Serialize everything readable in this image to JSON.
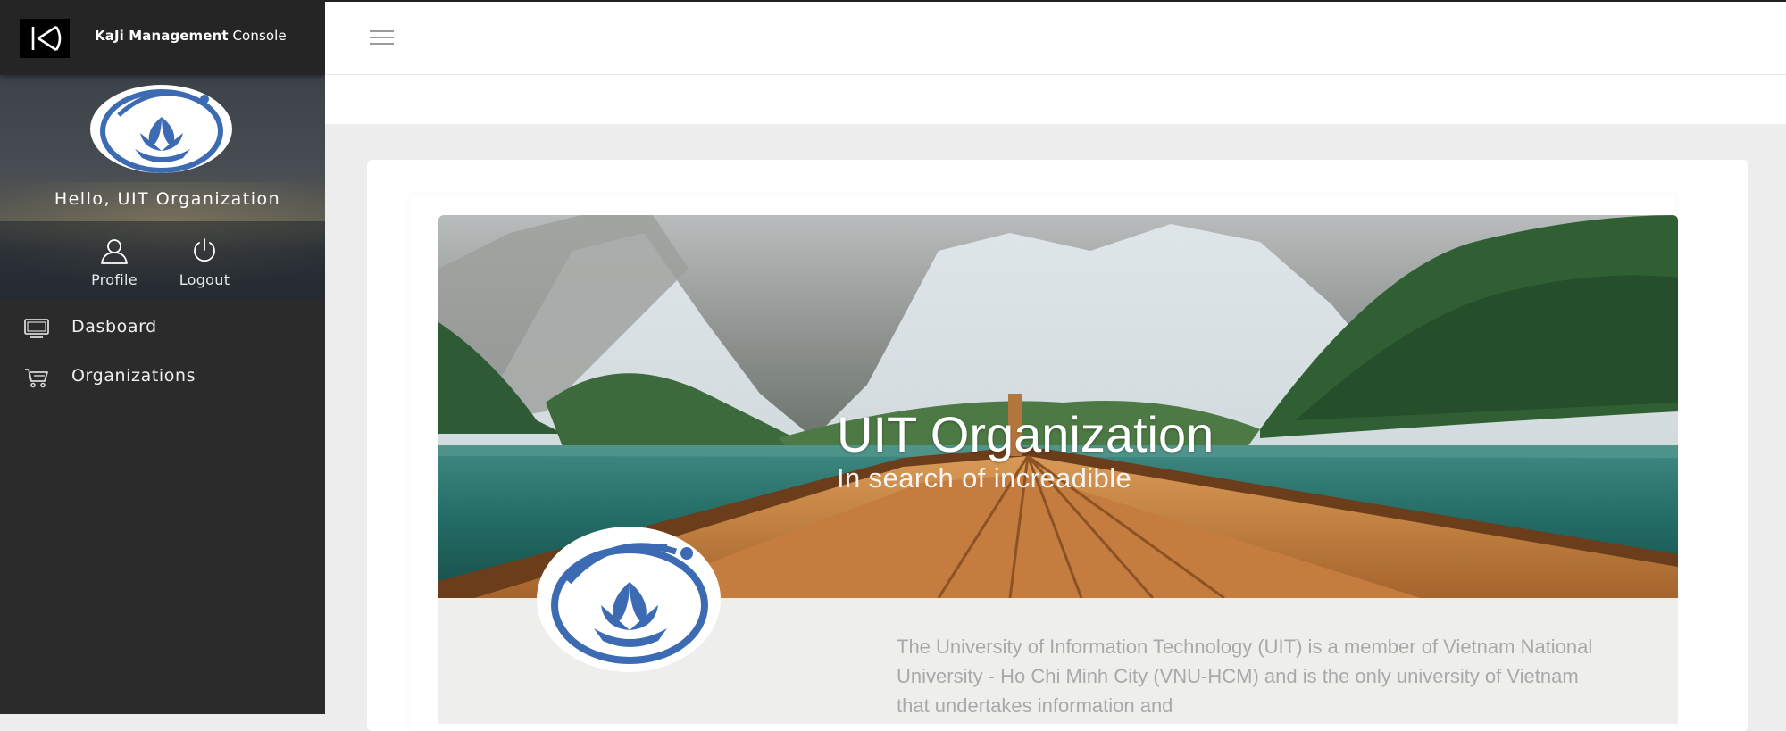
{
  "app": {
    "brand_bold": "KaJi Management",
    "brand_light": "Console",
    "logo_icon": "kaji-logo-icon"
  },
  "sidebar": {
    "greeting": "Hello, UIT Organization",
    "user_actions": [
      {
        "label": "Profile",
        "icon": "user-icon"
      },
      {
        "label": "Logout",
        "icon": "power-icon"
      }
    ],
    "items": [
      {
        "label": "Dasboard",
        "icon": "monitor-icon"
      },
      {
        "label": "Organizations",
        "icon": "cart-icon"
      }
    ]
  },
  "header": {
    "menu_icon": "hamburger-icon"
  },
  "organization": {
    "name": "UIT Organization",
    "tagline": "In search of increadible",
    "description": "The University of Information Technology (UIT) is a member of Vietnam National University - Ho Chi Minh City (VNU-HCM) and is the only university of Vietnam that undertakes information and"
  },
  "colors": {
    "sidebar_bg": "#2b2b2b",
    "accent_blue": "#3d6bb3",
    "page_bg": "#ededed"
  }
}
